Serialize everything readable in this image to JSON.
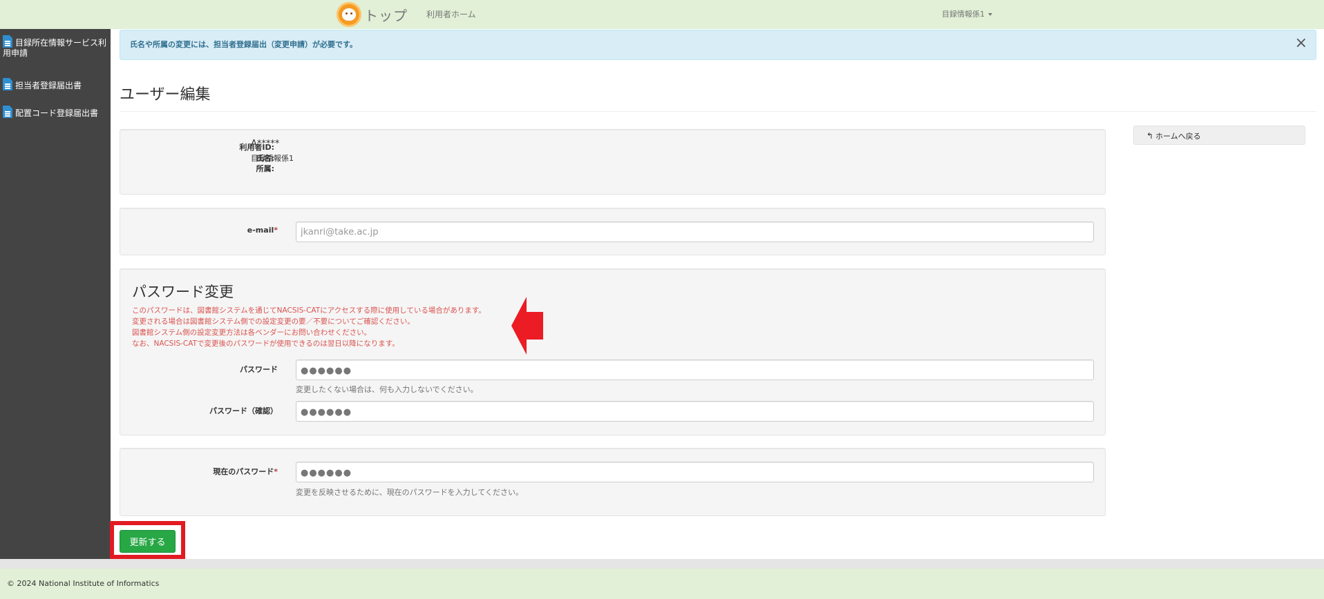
{
  "navbar": {
    "brand_text": "トップ",
    "home_link": "利用者ホーム",
    "user_menu": "目録情報係1"
  },
  "sidebar": {
    "items": [
      {
        "label": "目録所在情報サービス利用申請",
        "icon": "document-icon"
      },
      {
        "label": "担当者登録届出書",
        "icon": "document-icon"
      },
      {
        "label": "配置コード登録届出書",
        "icon": "document-icon"
      }
    ]
  },
  "alert": {
    "text": "氏名や所属の変更には、担当者登録届出（変更申請）が必要です。",
    "close": "×"
  },
  "page": {
    "title": "ユーザー編集"
  },
  "profile": {
    "user_id_label": "利用者ID:",
    "user_id_value": "A*****",
    "name_label": "氏名:",
    "name_value": "目録情報係1",
    "affiliation_label": "所属:",
    "affiliation_value": ""
  },
  "email": {
    "label": "e-mail",
    "required": "*",
    "placeholder": "jkanri@take.ac.jp"
  },
  "password_change": {
    "heading": "パスワード変更",
    "notes": [
      "このパスワードは、図書館システムを通じてNACSIS-CATにアクセスする際に使用している場合があります。",
      "変更される場合は図書館システム側での設定変更の要／不要についてご確認ください。",
      "図書館システム側の設定変更方法は各ベンダーにお問い合わせください。",
      "なお、NACSIS-CATで変更後のパスワードが使用できるのは翌日以降になります。"
    ],
    "password_label": "パスワード",
    "password_value": "●●●●●●",
    "password_help": "変更したくない場合は、何も入力しないでください。",
    "confirm_label": "パスワード（確認）",
    "confirm_value": "●●●●●●"
  },
  "current_password": {
    "label": "現在のパスワード",
    "required": "*",
    "value": "●●●●●●",
    "help": "変更を反映させるために、現在のパスワードを入力してください。"
  },
  "actions": {
    "back_label": "ホームへ戻る",
    "submit_label": "更新する"
  },
  "footer": {
    "copyright": "© 2024 National Institute of Informatics"
  },
  "colors": {
    "navbar_bg": "#e1f0d6",
    "sidebar_bg": "#444444",
    "alert_bg": "#d9edf7",
    "submit_green": "#28a745",
    "highlight_red": "#e21b23",
    "note_red": "#d9534f"
  }
}
